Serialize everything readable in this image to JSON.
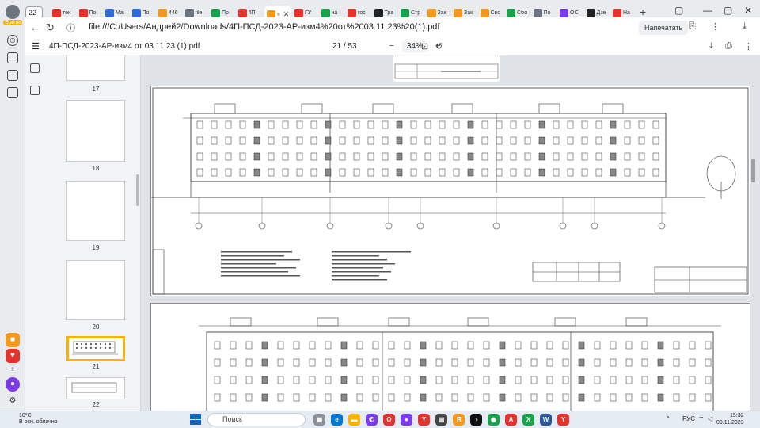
{
  "profile": {
    "label": "Войти"
  },
  "tabs": {
    "count": "22",
    "items": [
      {
        "label": "тек",
        "color": "#e5322d"
      },
      {
        "label": "По",
        "color": "#e5322d"
      },
      {
        "label": "Ма",
        "color": "#2f6bd8"
      },
      {
        "label": "По",
        "color": "#2f6bd8"
      },
      {
        "label": "446",
        "color": "#f39a1e"
      },
      {
        "label": "file",
        "color": "#6d7580"
      },
      {
        "label": "Пр",
        "color": "#16a34a"
      },
      {
        "label": "4П",
        "color": "#e5322d"
      },
      {
        "label": "«",
        "color": "#f39a1e",
        "active": true
      },
      {
        "label": "ГУ",
        "color": "#e5322d"
      },
      {
        "label": "на",
        "color": "#16a34a"
      },
      {
        "label": "гос",
        "color": "#e5322d"
      },
      {
        "label": "Тра",
        "color": "#222222"
      },
      {
        "label": "Стр",
        "color": "#16a34a"
      },
      {
        "label": "Зак",
        "color": "#f39a1e"
      },
      {
        "label": "Зак",
        "color": "#f39a1e"
      },
      {
        "label": "Сво",
        "color": "#f39a1e"
      },
      {
        "label": "Сбо",
        "color": "#16a34a"
      },
      {
        "label": "По",
        "color": "#6d7580"
      },
      {
        "label": "ОС",
        "color": "#7c3aed"
      },
      {
        "label": "Дзе",
        "color": "#222222"
      },
      {
        "label": "На",
        "color": "#e5322d"
      }
    ]
  },
  "address": {
    "url": "file:///C:/Users/Андрей2/Downloads/4П-ПСД-2023-АР-изм4%20от%2003.11.23%20(1).pdf",
    "translate_label": "Напечатать"
  },
  "pdf": {
    "filename": "4П-ПСД-2023-АР-изм4 от 03.11.23 (1).pdf",
    "current_page": "21",
    "total_pages": "53",
    "page_sep": "/",
    "zoom": "34%",
    "zoom_minus": "−",
    "zoom_plus": "+"
  },
  "thumbnails": [
    {
      "number": "17"
    },
    {
      "number": "18"
    },
    {
      "number": "19"
    },
    {
      "number": "20"
    },
    {
      "number": "21",
      "selected": true
    },
    {
      "number": "22"
    }
  ],
  "taskbar": {
    "weather_temp": "10°C",
    "weather_desc": "В осн. облачно",
    "search_placeholder": "Поиск",
    "lang": "РУС",
    "time": "15:32",
    "date": "09.11.2023"
  }
}
